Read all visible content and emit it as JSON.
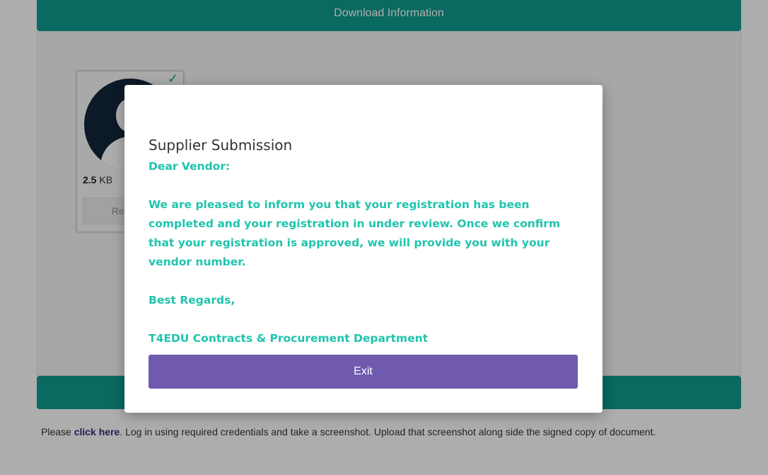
{
  "background": {
    "download_bar_label": "Download Information",
    "file_card": {
      "size_value": "2.5",
      "size_unit": "KB",
      "remove_label": "Remove"
    },
    "footer": {
      "text_before": "Please ",
      "link_text": "click here",
      "text_after": ". Log in using required credentials and take a screenshot. Upload that screenshot along side the signed copy of document."
    }
  },
  "modal": {
    "title": "Supplier Submission",
    "greeting": "Dear Vendor:",
    "message": "We are pleased to inform you that your registration has been completed and your registration in under review. Once we confirm that your registration is approved, we will provide you with your vendor number.",
    "closing": "Best Regards,",
    "signature": "T4EDU Contracts & Procurement Department",
    "exit_label": "Exit"
  },
  "colors": {
    "teal_bar": "#0f9b8e",
    "modal_text": "#1fc4ad",
    "exit_button": "#6f5aae",
    "link": "#3b2a7a"
  }
}
